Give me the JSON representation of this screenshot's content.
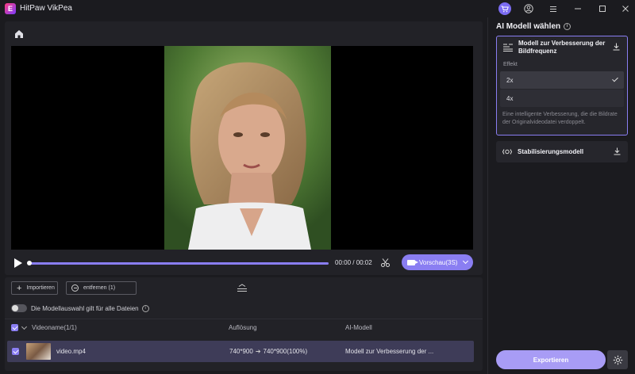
{
  "app": {
    "title": "HitPaw VikPea",
    "logo_letter": "E"
  },
  "titlebar": {
    "icons": [
      "cart-icon",
      "account-icon",
      "menu-icon",
      "minimize-icon",
      "maximize-icon",
      "close-icon"
    ]
  },
  "player": {
    "time": "00:00 / 00:02",
    "preview_label": "Vorschau(3S)",
    "progress": 0
  },
  "file_panel": {
    "import_label": "Importieren",
    "remove_label": "entfernen (1)",
    "toggle_label": "Die Modellauswahl gilt für alle Dateien",
    "columns": {
      "name": "Videoname(1/1)",
      "resolution": "Auflösung",
      "model": "AI-Modell"
    },
    "rows": [
      {
        "name": "video.mp4",
        "resolution_from": "740*900",
        "resolution_to": "740*900(100%)",
        "model": "Modell zur Verbesserung der ..."
      }
    ]
  },
  "right_panel": {
    "title": "AI Modell wählen",
    "selected_model": {
      "title": "Modell zur Verbesserung der Bildfrequenz",
      "effect_label": "Effekt",
      "options": [
        "2x",
        "4x"
      ],
      "selected_option": "2x",
      "description": "Eine intelligente Verbesserung, die die Bildrate der Originalvideodatei verdoppelt."
    },
    "other_model": {
      "title": "Stabilisierungsmodell"
    },
    "export_label": "Exportieren"
  },
  "colors": {
    "accent": "#8a7ef2",
    "export": "#a89cf5",
    "background": "#1b1b1f",
    "panel": "#222227"
  }
}
